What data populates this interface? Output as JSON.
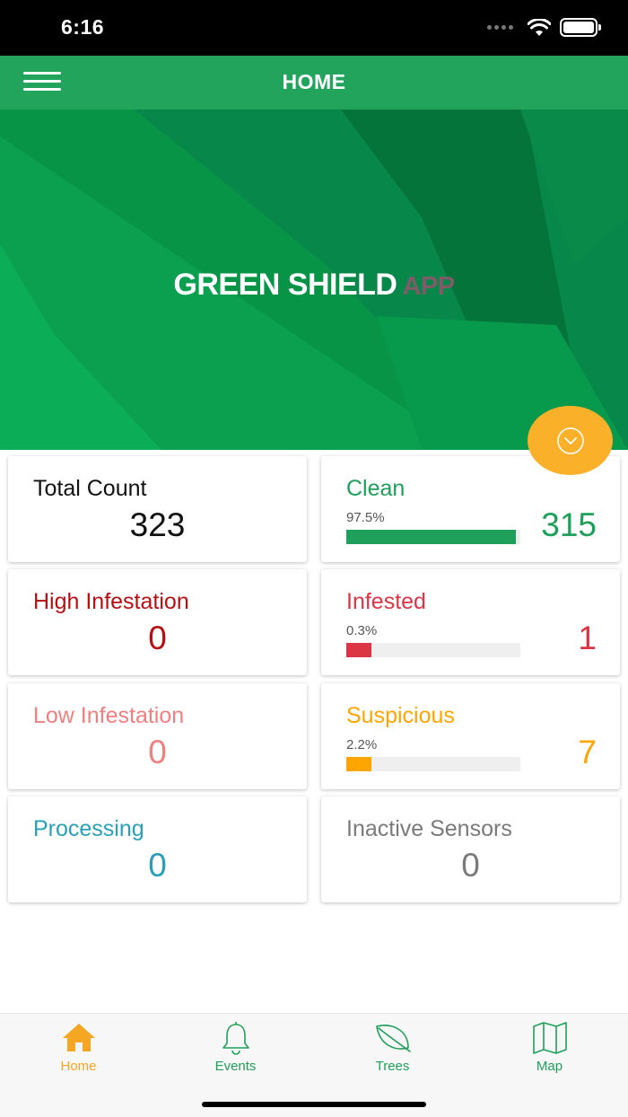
{
  "status_bar": {
    "time": "6:16"
  },
  "header": {
    "title": "HOME"
  },
  "hero": {
    "brand_main": "GREEN SHIELD",
    "brand_sub": "APP"
  },
  "colors": {
    "header_green": "#22a45d",
    "clean_green": "#1fa05a",
    "high_infestation": "#b80f12",
    "infested": "#dc3545",
    "low_infestation": "#f08080",
    "suspicious": "#ffa500",
    "processing": "#2aa0b8",
    "inactive": "#7a7a7a",
    "fab": "#fbb02a",
    "tab_active": "#f5a623",
    "tab_inactive": "#1fa05a"
  },
  "cards": {
    "total_count": {
      "title": "Total Count",
      "value": "323"
    },
    "clean": {
      "title": "Clean",
      "percent": "97.5%",
      "fraction": 0.975,
      "value": "315"
    },
    "high_infestation": {
      "title": "High Infestation",
      "value": "0"
    },
    "infested": {
      "title": "Infested",
      "percent": "0.3%",
      "fraction": 0.003,
      "value": "1"
    },
    "low_infestation": {
      "title": "Low Infestation",
      "value": "0"
    },
    "suspicious": {
      "title": "Suspicious",
      "percent": "2.2%",
      "fraction": 0.022,
      "value": "7"
    },
    "processing": {
      "title": "Processing",
      "value": "0"
    },
    "inactive_sensors": {
      "title": "Inactive Sensors",
      "value": "0"
    }
  },
  "tabs": [
    {
      "label": "Home",
      "icon": "home-icon",
      "active": true
    },
    {
      "label": "Events",
      "icon": "bell-icon",
      "active": false
    },
    {
      "label": "Trees",
      "icon": "leaf-icon",
      "active": false
    },
    {
      "label": "Map",
      "icon": "map-icon",
      "active": false
    }
  ]
}
